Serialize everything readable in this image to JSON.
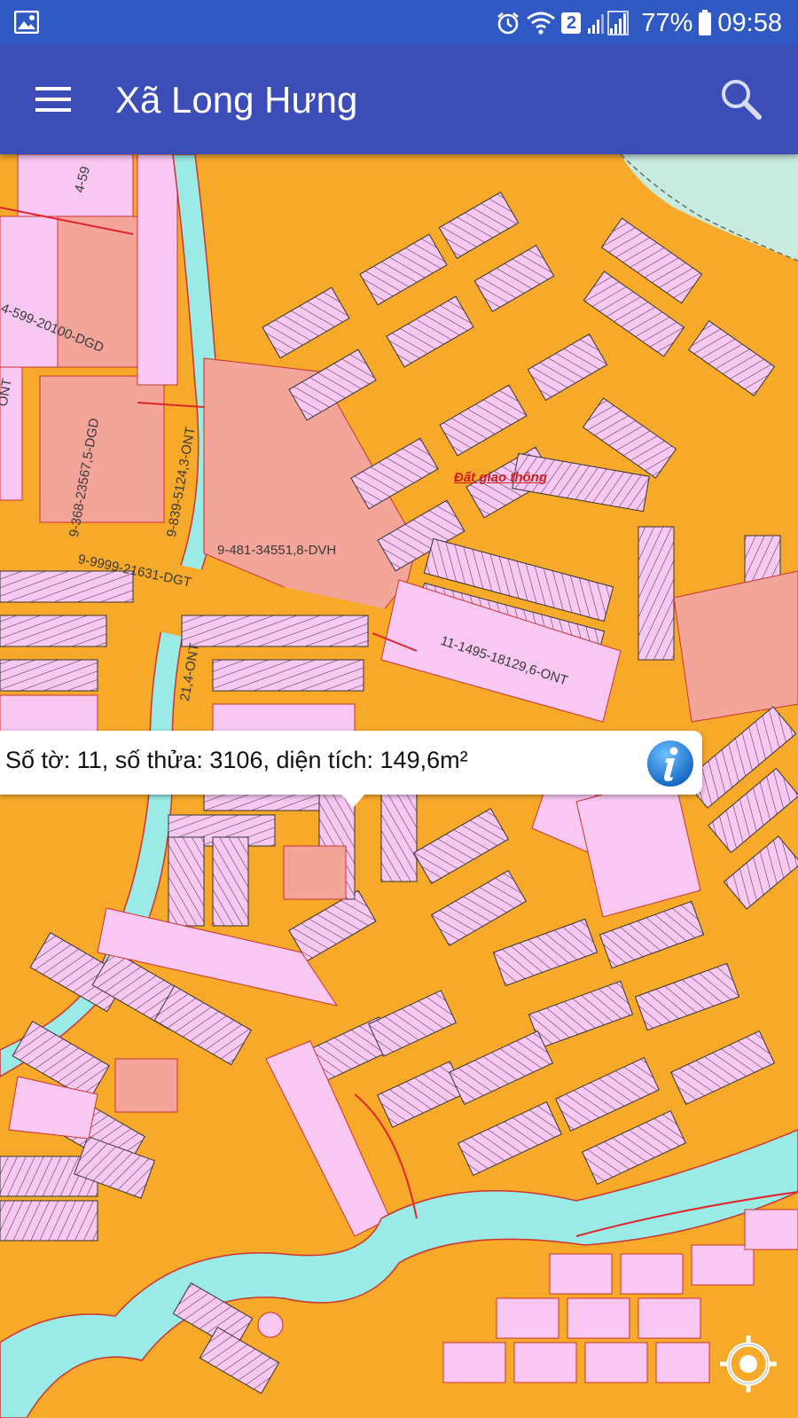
{
  "status_bar": {
    "battery": "77%",
    "time": "09:58",
    "sim_badge": "2"
  },
  "app_bar": {
    "title": "Xã Long Hưng"
  },
  "map": {
    "labels": {
      "parcel_1": "4-599-20100-DGD",
      "parcel_2": "9-368-23567,5-DGD",
      "parcel_3": "9-839-5124,3-ONT",
      "parcel_4": "9-481-34551,8-DVH",
      "parcel_5": "9-9999-21631-DGT",
      "parcel_6": "11-1495-18129,6-ONT",
      "parcel_7": "21,4-ONT",
      "parcel_top": "4-59",
      "parcel_left": "ONT",
      "road_label": "Đất giao thông"
    },
    "colors": {
      "road": "#f7a92a",
      "residential": "#f8c8f3",
      "public": "#f4a59a",
      "water": "#9aebe6",
      "river": "#c8ebe0",
      "boundary": "#e0242a"
    }
  },
  "popup": {
    "text": "Số tờ: 11, số thửa: 3106, diện tích: 149,6m²"
  },
  "icons": {
    "menu": "hamburger-menu-icon",
    "search": "search-icon",
    "info": "info-icon",
    "locate": "my-location-icon"
  }
}
